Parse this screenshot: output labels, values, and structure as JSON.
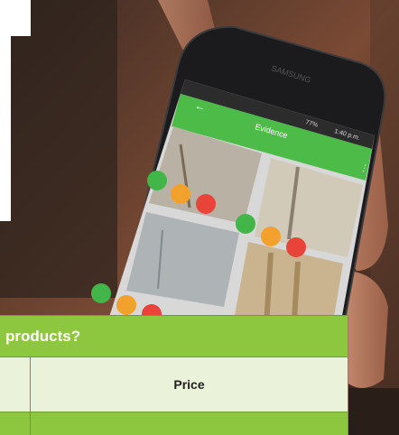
{
  "phone": {
    "brand": "SAMSUNG",
    "status_time": "1:40 p.m.",
    "status_battery": "77%",
    "app_title": "Evidence",
    "colors": {
      "app_bar": "#4cbb47",
      "action_green": "#43b649",
      "action_orange": "#f2a22c",
      "action_red": "#e8443a"
    }
  },
  "table": {
    "header_text": "products?",
    "column_price": "Price",
    "accent_color": "#8dc63f",
    "light_color": "#eaf3d9"
  }
}
